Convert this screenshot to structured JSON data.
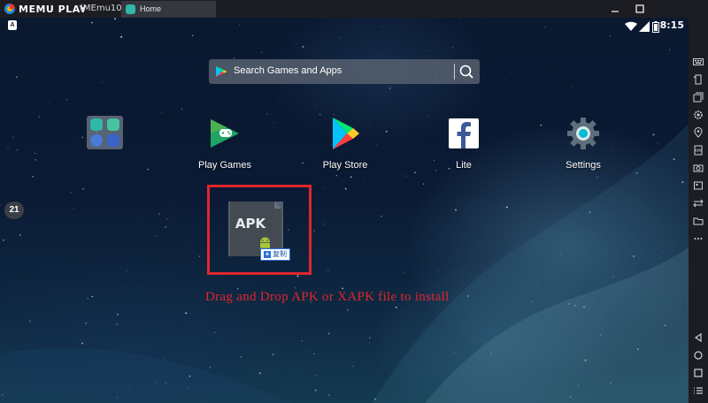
{
  "titlebar": {
    "app_name": "MEMU PLAY",
    "instance": "(MEmu10)",
    "tab_label": "Home"
  },
  "status_bar": {
    "time": "8:15",
    "notification_icon": "A"
  },
  "search": {
    "placeholder": "Search Games and Apps"
  },
  "apps": [
    {
      "label": "Play Games",
      "icon": "play-games-icon"
    },
    {
      "label": "Play Store",
      "icon": "play-store-icon"
    },
    {
      "label": "Lite",
      "icon": "facebook-icon"
    },
    {
      "label": "Settings",
      "icon": "settings-icon"
    }
  ],
  "dock_clock": "21",
  "drop": {
    "file_label": "APK",
    "copy_label": "复制",
    "hint": "Drag and Drop APK or XAPK file to install"
  },
  "colors": {
    "accent_red": "#e0262d",
    "titlebar": "#1b1d22",
    "tab_accent": "#2fb7a8"
  }
}
